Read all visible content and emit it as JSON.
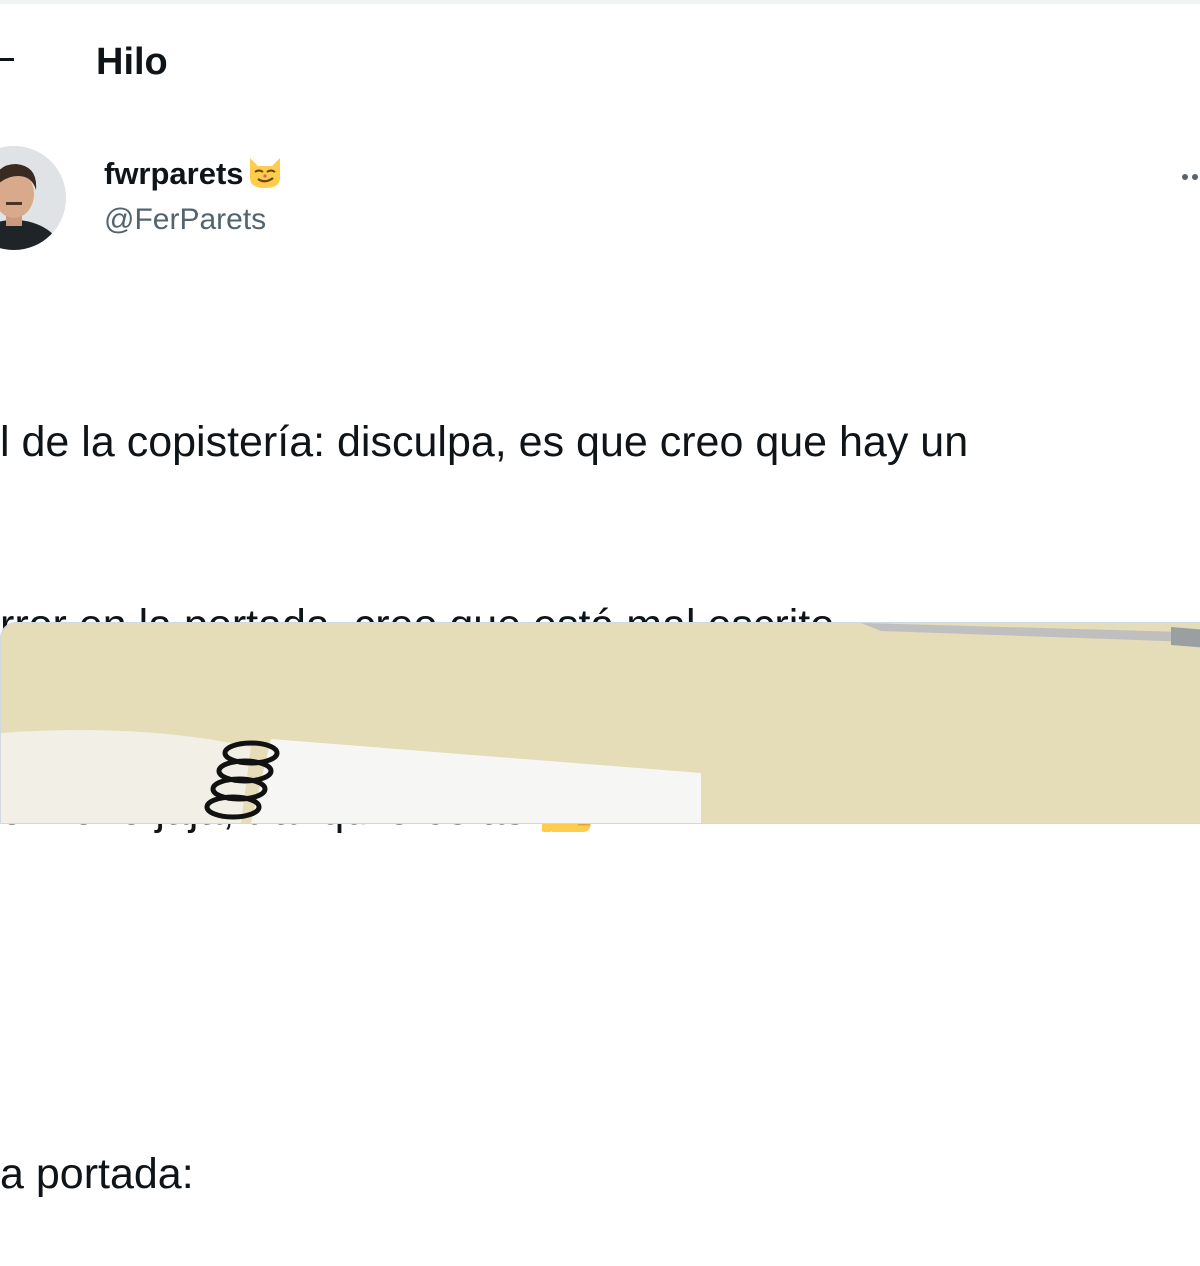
{
  "header": {
    "title": "Hilo",
    "back_icon": "arrow-left-icon"
  },
  "tweet": {
    "display_name": "fwrparets",
    "name_emoji": "smirking-cat-icon",
    "handle": "@FerParets",
    "more_icon": "more-horizontal-icon",
    "lines": [
      "l de la copistería: disculpa, es que creo que hay un",
      "rror en la portada, creo que está mal escrito",
      "o: nono jaja, tranquilo es así",
      "",
      "a portada:"
    ],
    "line3_emoji": "thumbs-up-icon"
  },
  "colors": {
    "text_primary": "#0f1419",
    "text_secondary": "#536471",
    "divider": "#eff3f4",
    "photo_background": "#e2d8b4"
  }
}
